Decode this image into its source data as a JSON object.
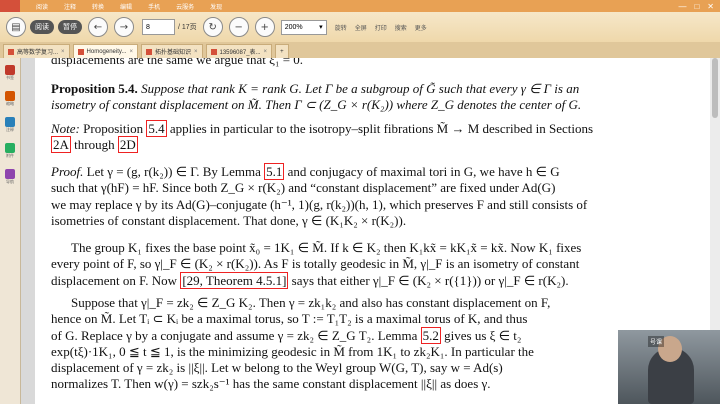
{
  "menubar": {
    "items": [
      "阅读",
      "注释",
      "转换",
      "编辑",
      "手机",
      "云服务",
      "发现"
    ]
  },
  "toolbar": {
    "pill1": "阅读",
    "pill2": "暂停",
    "page_input": "8",
    "page_total": "/ 17页",
    "zoom": "200%",
    "labels": [
      "旋转",
      "全屏",
      "打印",
      "搜索",
      "更多"
    ]
  },
  "tabs": [
    {
      "label": "高等数学复习..."
    },
    {
      "label": "Homogeneity..."
    },
    {
      "label": "拓扑基础知识"
    },
    {
      "label": "13596087_表..."
    }
  ],
  "sidebar": {
    "items": [
      "书签",
      "缩略",
      "注释",
      "附件",
      "导航"
    ]
  },
  "doc": {
    "l0": "displacements are the same we argue that ξ₁ = 0.",
    "prop_head": "Proposition 5.4.",
    "prop_l1": "Suppose that rank K = rank G.  Let Γ be a subgroup of G̃ such that every γ ∈ Γ is an",
    "prop_l2": "isometry of constant displacement on M̃.  Then Γ ⊂ (Z_G × r(K₂)) where Z_G denotes the center of G.",
    "note_a": "Note:",
    "note_b": " Proposition ",
    "note_ref1": "5.4",
    "note_c": " applies in particular to the isotropy–split fibrations M̃ → M described in Sections",
    "note_ref2": "2A",
    "note_d": " through ",
    "note_ref3": "2D",
    "proof_a": "Proof.",
    "proof_b": " Let γ = (g, r(k₂)) ∈ Γ.  By Lemma ",
    "proof_ref1": "5.1",
    "proof_c": " and conjugacy of maximal tori in G, we have h ∈ G",
    "pl2": "such that γ(hF) = hF.  Since both Z_G × r(K₂) and “constant displacement” are fixed under Ad(G)",
    "pl3": "we may replace γ by its Ad(G)–conjugate (h⁻¹, 1)(g, r(k₂))(h, 1), which preserves F and still consists of",
    "pl4": "isometries of constant displacement.  That done, γ ∈ (K₁K₂ × r(K₂)).",
    "gl1": "The group K₁ fixes the base point x̃₀ = 1K₁ ∈ M̃.  If k ∈ K₂ then K₁kx̃ = kK₁x̃ = kx̃.  Now K₁ fixes",
    "gl2": "every point of F, so γ|_F ∈ (K₂ × r(K₂)).  As F is totally geodesic in M̃, γ|_F is an isometry of constant",
    "gl3_a": "displacement on F.  Now ",
    "gl3_ref": "[29, Theorem 4.5.1]",
    "gl3_b": " says that either γ|_F ∈ (K₂ × r({1})) or γ|_F ∈ r(K₂).",
    "sl1": "Suppose that γ|_F = zk₂ ∈ Z_G K₂.  Then γ = zk₁k₂ and also has constant displacement on F,",
    "sl2": "hence on M̃.  Let Tᵢ ⊂ Kᵢ be a maximal torus, so T := T₁T₂ is a maximal torus of K, and thus",
    "sl3_a": "of G.  Replace γ by a conjugate and assume γ = zk₂ ∈ Z_G T₂.  Lemma ",
    "sl3_ref": "5.2",
    "sl3_b": " gives us ξ ∈ t₂",
    "sl4": "exp(tξ)·1K₁, 0 ≦ t ≦ 1, is the minimizing geodesic in M̃ from 1K₁ to zk₂K₁.  In particular the",
    "sl5": "displacement of γ = zk₂ is ||ξ||.  Let w belong to the Weyl group W(G, T), say w = Ad(s)",
    "sl6": "normalizes T.  Then w(γ) = szk₂s⁻¹ has the same constant displacement ||ξ|| as does γ."
  },
  "video": {
    "watermark": "号课"
  },
  "colors": {
    "menubar": "#e8a154",
    "ref_box": "#ee2222"
  }
}
